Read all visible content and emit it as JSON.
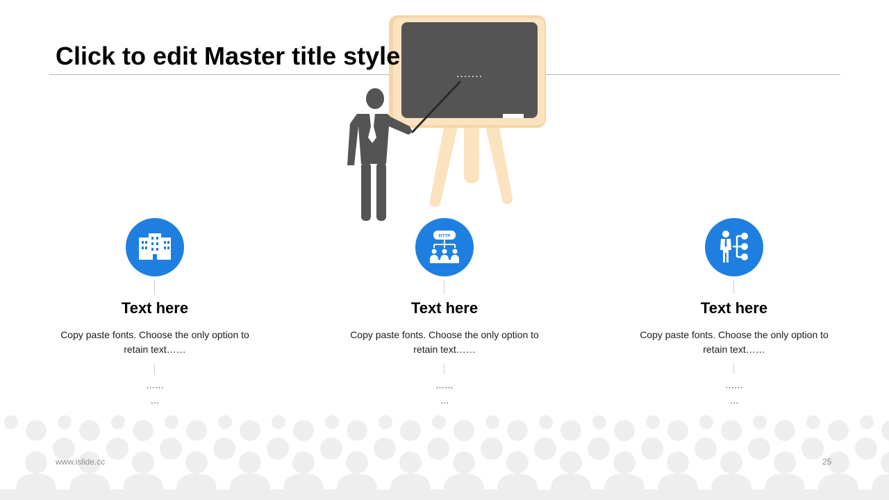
{
  "slide": {
    "title": "Click to edit Master title style",
    "board_text": ".......",
    "footer_url": "www.islide.cc",
    "page_number": "25"
  },
  "colors": {
    "accent": "#1e7fe0",
    "rule": "#b3b3b3",
    "board": "#545454",
    "easel": "#fce3c0",
    "crowd": "#eeeeee"
  },
  "columns": [
    {
      "icon": "building-icon",
      "heading": "Text here",
      "description": "Copy paste fonts. Choose the only option to retain text……",
      "dots_1": "……",
      "dots_2": "…"
    },
    {
      "icon": "http-network-icon",
      "heading": "Text here",
      "description": "Copy paste fonts. Choose the only option to retain text……",
      "dots_1": "……",
      "dots_2": "…"
    },
    {
      "icon": "person-org-chart-icon",
      "heading": "Text here",
      "description": "Copy paste fonts. Choose the only option to retain text……",
      "dots_1": "……",
      "dots_2": "…"
    }
  ]
}
